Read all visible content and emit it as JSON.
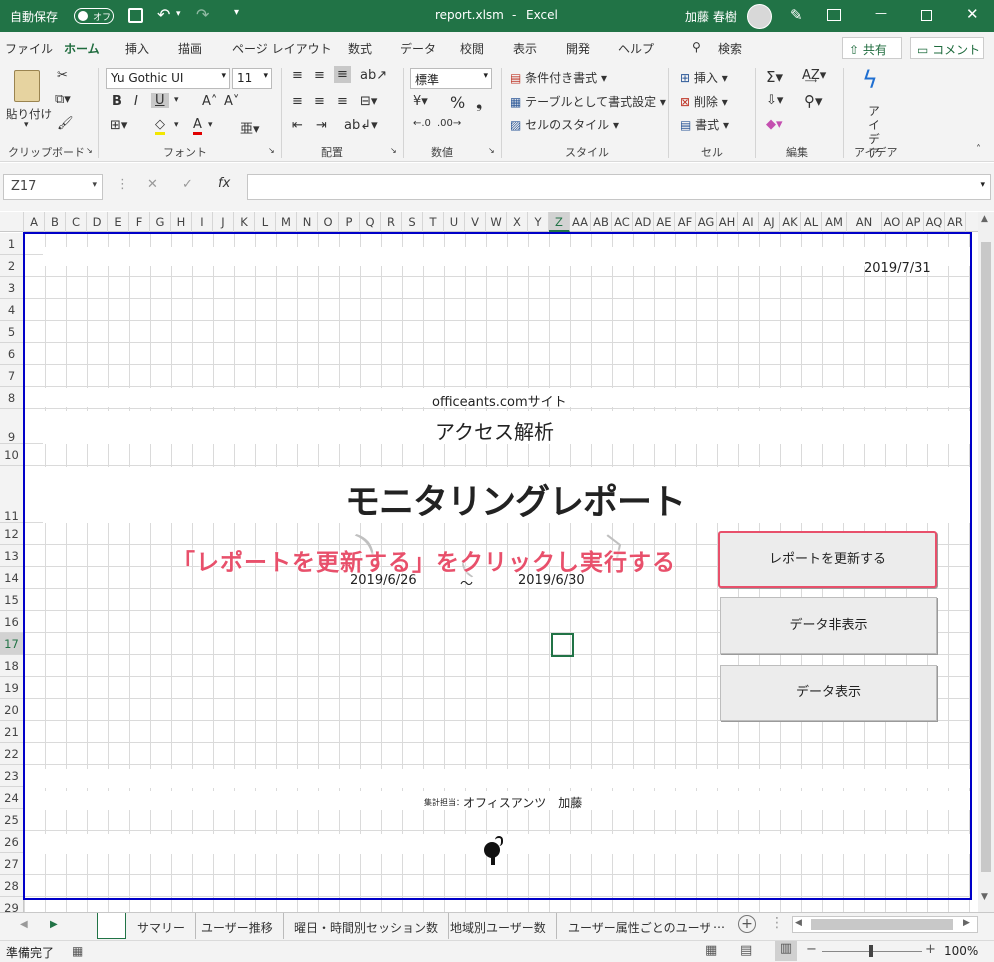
{
  "titlebar": {
    "autosave_label": "自動保存",
    "autosave_state": "オフ",
    "filename": "report.xlsm",
    "app": "Excel",
    "separator": "-",
    "user": "加藤 春樹"
  },
  "menu": {
    "tabs": [
      "ファイル",
      "ホーム",
      "挿入",
      "描画",
      "ページ レイアウト",
      "数式",
      "データ",
      "校閲",
      "表示",
      "開発",
      "ヘルプ"
    ],
    "search": "検索",
    "share": "共有",
    "comment": "コメント"
  },
  "ribbon": {
    "clipboard": {
      "paste": "貼り付け",
      "label": "クリップボード"
    },
    "font": {
      "name": "Yu Gothic UI",
      "size": "11",
      "label": "フォント",
      "bold": "B",
      "italic": "I",
      "underline": "U"
    },
    "alignment": {
      "label": "配置"
    },
    "number": {
      "format": "標準",
      "label": "数値"
    },
    "styles": {
      "conditional": "条件付き書式",
      "table": "テーブルとして書式設定",
      "cell": "セルのスタイル",
      "label": "スタイル"
    },
    "cells": {
      "insert": "挿入",
      "delete": "削除",
      "format": "書式",
      "label": "セル"
    },
    "editing": {
      "label": "編集"
    },
    "ideas": {
      "button": "アイデア",
      "label": "アイデア"
    }
  },
  "formula_bar": {
    "name_box": "Z17",
    "value": ""
  },
  "columns": [
    "A",
    "B",
    "C",
    "D",
    "E",
    "F",
    "G",
    "H",
    "I",
    "J",
    "K",
    "L",
    "M",
    "N",
    "O",
    "P",
    "Q",
    "R",
    "S",
    "T",
    "U",
    "V",
    "W",
    "X",
    "Y",
    "Z",
    "AA",
    "AB",
    "AC",
    "AD",
    "AE",
    "AF",
    "AG",
    "AH",
    "AI",
    "AJ",
    "AK",
    "AL",
    "AM",
    "AN",
    "AO",
    "AP",
    "AQ",
    "AR"
  ],
  "rows": [
    "1",
    "2",
    "3",
    "4",
    "5",
    "6",
    "7",
    "8",
    "9",
    "10",
    "11",
    "12",
    "13",
    "14",
    "15",
    "16",
    "17",
    "18",
    "19",
    "20",
    "21",
    "22",
    "23",
    "24",
    "25",
    "26",
    "27",
    "28",
    "29"
  ],
  "sheet": {
    "date": "2019/7/31",
    "site": "officeants.comサイト",
    "subtitle": "アクセス解析",
    "title": "モニタリングレポート",
    "period_start": "2019/6/26",
    "tilde": "～",
    "period_end": "2019/6/30",
    "author_label": "集計担当：",
    "author": "オフィスアンツ　加藤",
    "annotation": "「レポートを更新する」をクリックし実行する"
  },
  "buttons": {
    "refresh": "レポートを更新する",
    "hide": "データ非表示",
    "show": "データ表示"
  },
  "sheet_tabs": [
    "",
    "サマリー",
    "ユーザー推移",
    "曜日・時間別セッション数",
    "地域別ユーザー数",
    "ユーザー属性ごとのユーザ-"
  ],
  "status": {
    "ready": "準備完了",
    "zoom": "100%"
  },
  "colors": {
    "excel_green": "#217346",
    "annotation": "#e8506b",
    "page_border": "#0000c8"
  }
}
